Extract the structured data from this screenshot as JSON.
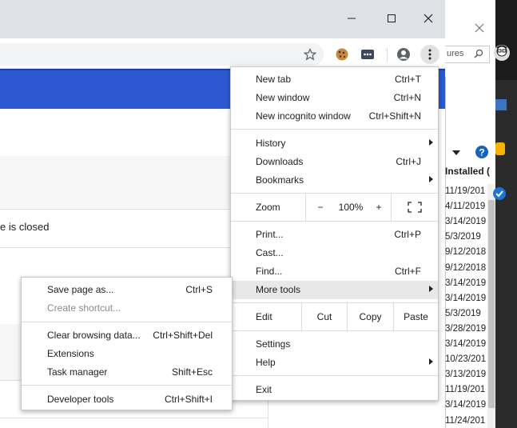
{
  "window": {
    "minimize_icon": "minimize-icon",
    "maximize_icon": "maximize-icon",
    "close_icon": "close-icon"
  },
  "toolbar": {
    "icons": [
      "bookmark-star-icon",
      "cookie-extension-icon",
      "extension-dots-icon",
      "profile-icon",
      "kebab-menu-icon"
    ]
  },
  "page": {
    "closed_text": "e is closed"
  },
  "menu": {
    "new_tab": {
      "label": "New tab",
      "shortcut": "Ctrl+T"
    },
    "new_window": {
      "label": "New window",
      "shortcut": "Ctrl+N"
    },
    "new_incognito": {
      "label": "New incognito window",
      "shortcut": "Ctrl+Shift+N"
    },
    "history": {
      "label": "History"
    },
    "downloads": {
      "label": "Downloads",
      "shortcut": "Ctrl+J"
    },
    "bookmarks": {
      "label": "Bookmarks"
    },
    "zoom": {
      "label": "Zoom",
      "minus": "−",
      "value": "100%",
      "plus": "+"
    },
    "print": {
      "label": "Print...",
      "shortcut": "Ctrl+P"
    },
    "cast": {
      "label": "Cast..."
    },
    "find": {
      "label": "Find...",
      "shortcut": "Ctrl+F"
    },
    "more_tools": {
      "label": "More tools"
    },
    "edit": {
      "label": "Edit",
      "cut": "Cut",
      "copy": "Copy",
      "paste": "Paste"
    },
    "settings": {
      "label": "Settings"
    },
    "help": {
      "label": "Help"
    },
    "exit": {
      "label": "Exit"
    }
  },
  "submenu": {
    "save_page": {
      "label": "Save page as...",
      "shortcut": "Ctrl+S"
    },
    "create_shortcut": {
      "label": "Create shortcut..."
    },
    "clear_data": {
      "label": "Clear browsing data...",
      "shortcut": "Ctrl+Shift+Del"
    },
    "extensions": {
      "label": "Extensions"
    },
    "task_manager": {
      "label": "Task manager",
      "shortcut": "Shift+Esc"
    },
    "dev_tools": {
      "label": "Developer tools",
      "shortcut": "Ctrl+Shift+I"
    }
  },
  "bg_window": {
    "search_text": "ures",
    "installed_header": "Installed (",
    "dates": [
      "11/19/201",
      "4/11/2019",
      "3/14/2019",
      "5/3/2019",
      "9/12/2018",
      "9/12/2018",
      "3/14/2019",
      "3/14/2019",
      "5/3/2019",
      "3/28/2019",
      "3/14/2019",
      "10/23/201",
      "3/13/2019",
      "11/19/201",
      "3/14/2019",
      "11/24/201"
    ]
  },
  "colors": {
    "blue_bar": "#2a59d1",
    "menu_highlight": "#e8e8e8"
  }
}
